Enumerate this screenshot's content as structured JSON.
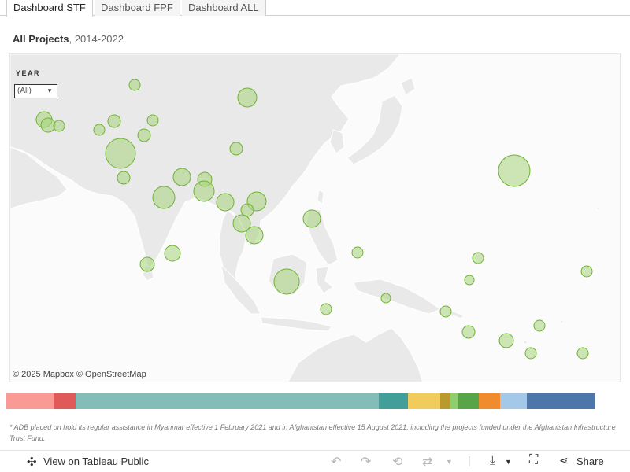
{
  "tabs": [
    {
      "label": "Dashboard STF",
      "active": true
    },
    {
      "label": "Dashboard FPF",
      "active": false
    },
    {
      "label": "Dashboard ALL",
      "active": false
    }
  ],
  "title": {
    "bold": "All Projects",
    "rest": ", 2014-2022"
  },
  "filter": {
    "label": "YEAR",
    "value": "(All)"
  },
  "map": {
    "attribution": "© 2025 Mapbox  © OpenStreetMap",
    "land_color": "#e9e9e9",
    "water_color": "#fbfbfb",
    "bubble_fill": "#a8d37a",
    "bubble_stroke": "#6fb335"
  },
  "color_strip": [
    "#f99a95",
    "#e05a5a",
    "#84bdb7",
    "#429e98",
    "#f0cc5c",
    "#b99a2c",
    "#8fcd6e",
    "#58a446",
    "#f08c2e",
    "#a3c8e8",
    "#4d77a8"
  ],
  "footnote": "* ADB placed on hold its regular assistance in Myanmar effective 1 February 2021 and in Afghanistan effective 15 August 2021, including the projects funded under the Afghanistan Infrastructure Trust Fund.",
  "toolbar": {
    "view_label": "View on Tableau Public",
    "share_label": "Share"
  }
}
